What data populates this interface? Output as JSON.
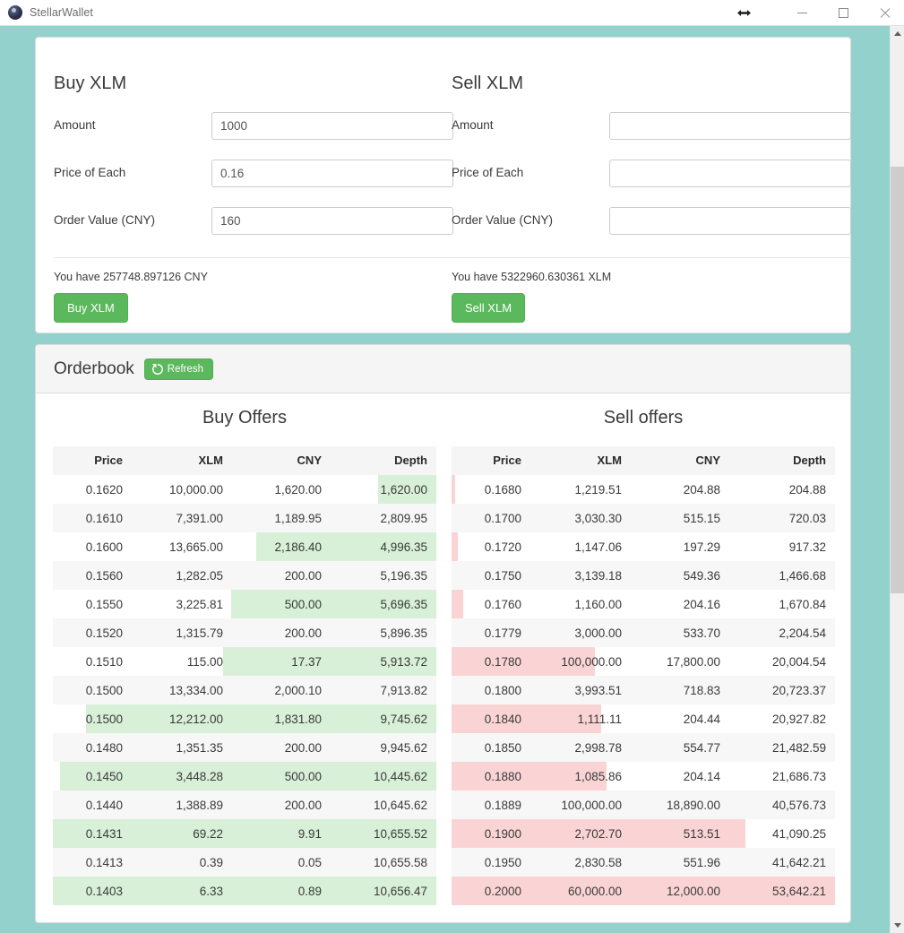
{
  "window": {
    "title": "StellarWallet",
    "controls": {
      "resize": "resize-handle",
      "minimize": "minimize",
      "maximize": "maximize",
      "close": "close"
    }
  },
  "theme": {
    "background": "#93d1cc",
    "button_green": "#5cb85c",
    "buy_depth": "#d8efd8",
    "sell_depth": "#fad4d4",
    "card_bg": "#ffffff",
    "header_bg": "#f5f5f5"
  },
  "buy_panel": {
    "title": "Buy XLM",
    "fields": [
      {
        "label": "Amount",
        "value": "1000",
        "placeholder": ""
      },
      {
        "label": "Price of Each",
        "value": "0.16",
        "placeholder": ""
      },
      {
        "label": "Order Value (CNY)",
        "value": "160",
        "placeholder": ""
      }
    ],
    "balance": "You have 257748.897126 CNY",
    "button": "Buy XLM"
  },
  "sell_panel": {
    "title": "Sell XLM",
    "fields": [
      {
        "label": "Amount",
        "value": "",
        "placeholder": ""
      },
      {
        "label": "Price of Each",
        "value": "",
        "placeholder": ""
      },
      {
        "label": "Order Value (CNY)",
        "value": "",
        "placeholder": ""
      }
    ],
    "balance": "You have 5322960.630361 XLM",
    "button": "Sell XLM"
  },
  "orderbook": {
    "title": "Orderbook",
    "refresh_label": "Refresh",
    "refresh_icon": "refresh-icon",
    "buy": {
      "heading": "Buy Offers",
      "columns": [
        "Price",
        "XLM",
        "CNY",
        "Depth"
      ],
      "rows": [
        [
          "0.1620",
          "10,000.00",
          "1,620.00",
          "1,620.00"
        ],
        [
          "0.1610",
          "7,391.00",
          "1,189.95",
          "2,809.95"
        ],
        [
          "0.1600",
          "13,665.00",
          "2,186.40",
          "4,996.35"
        ],
        [
          "0.1560",
          "1,282.05",
          "200.00",
          "5,196.35"
        ],
        [
          "0.1550",
          "3,225.81",
          "500.00",
          "5,696.35"
        ],
        [
          "0.1520",
          "1,315.79",
          "200.00",
          "5,896.35"
        ],
        [
          "0.1510",
          "115.00",
          "17.37",
          "5,913.72"
        ],
        [
          "0.1500",
          "13,334.00",
          "2,000.10",
          "7,913.82"
        ],
        [
          "0.1500",
          "12,212.00",
          "1,831.80",
          "9,745.62"
        ],
        [
          "0.1480",
          "1,351.35",
          "200.00",
          "9,945.62"
        ],
        [
          "0.1450",
          "3,448.28",
          "500.00",
          "10,445.62"
        ],
        [
          "0.1440",
          "1,388.89",
          "200.00",
          "10,645.62"
        ],
        [
          "0.1431",
          "69.22",
          "9.91",
          "10,655.52"
        ],
        [
          "0.1413",
          "0.39",
          "0.05",
          "10,655.58"
        ],
        [
          "0.1403",
          "6.33",
          "0.89",
          "10,656.47"
        ]
      ],
      "depth_values": [
        1620.0,
        2809.95,
        4996.35,
        5196.35,
        5696.35,
        5896.35,
        5913.72,
        7913.82,
        9745.62,
        9945.62,
        10445.62,
        10645.62,
        10655.52,
        10655.58,
        10656.47
      ],
      "depth_max": 10656.47
    },
    "sell": {
      "heading": "Sell offers",
      "columns": [
        "Price",
        "XLM",
        "CNY",
        "Depth"
      ],
      "rows": [
        [
          "0.1680",
          "1,219.51",
          "204.88",
          "204.88"
        ],
        [
          "0.1700",
          "3,030.30",
          "515.15",
          "720.03"
        ],
        [
          "0.1720",
          "1,147.06",
          "197.29",
          "917.32"
        ],
        [
          "0.1750",
          "3,139.18",
          "549.36",
          "1,466.68"
        ],
        [
          "0.1760",
          "1,160.00",
          "204.16",
          "1,670.84"
        ],
        [
          "0.1779",
          "3,000.00",
          "533.70",
          "2,204.54"
        ],
        [
          "0.1780",
          "100,000.00",
          "17,800.00",
          "20,004.54"
        ],
        [
          "0.1800",
          "3,993.51",
          "718.83",
          "20,723.37"
        ],
        [
          "0.1840",
          "1,111.11",
          "204.44",
          "20,927.82"
        ],
        [
          "0.1850",
          "2,998.78",
          "554.77",
          "21,482.59"
        ],
        [
          "0.1880",
          "1,085.86",
          "204.14",
          "21,686.73"
        ],
        [
          "0.1889",
          "100,000.00",
          "18,890.00",
          "40,576.73"
        ],
        [
          "0.1900",
          "2,702.70",
          "513.51",
          "41,090.25"
        ],
        [
          "0.1950",
          "2,830.58",
          "551.96",
          "41,642.21"
        ],
        [
          "0.2000",
          "60,000.00",
          "12,000.00",
          "53,642.21"
        ]
      ],
      "depth_values": [
        204.88,
        720.03,
        917.32,
        1466.68,
        1670.84,
        2204.54,
        20004.54,
        20723.37,
        20927.82,
        21482.59,
        21686.73,
        40576.73,
        41090.25,
        41642.21,
        53642.21
      ],
      "depth_max": 53642.21
    }
  }
}
